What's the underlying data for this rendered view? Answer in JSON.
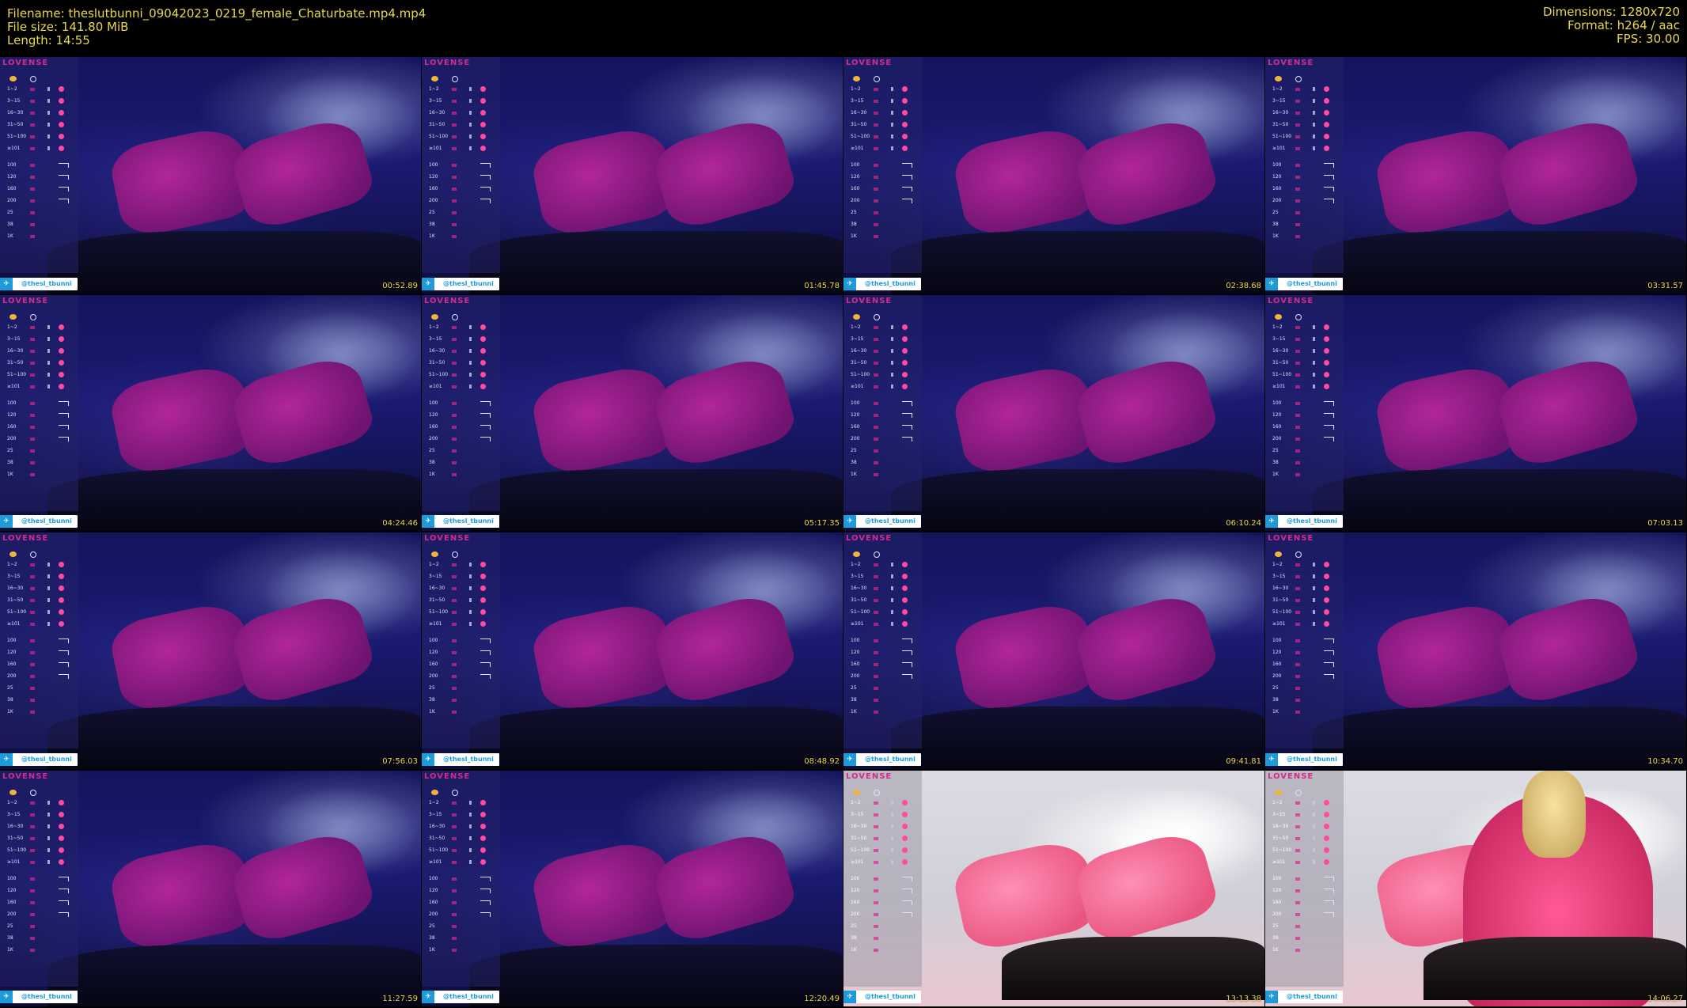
{
  "header": {
    "filename": "Filename: theslutbunni_09042023_0219_female_Chaturbate.mp4.mp4",
    "filesize": "File size: 141.80 MiB",
    "length": "Length: 14:55",
    "dimensions": "Dimensions: 1280x720",
    "format": "Format: h264 / aac",
    "fps": "FPS: 30.00"
  },
  "overlay": {
    "brand": "LOVENSE",
    "handle": "@thesl_tbunni",
    "tip_levels": [
      "1~2",
      "3~15",
      "16~30",
      "31~50",
      "51~100",
      "≥101"
    ],
    "patterns": [
      "100",
      "120",
      "160",
      "200"
    ],
    "extras": [
      "25",
      "38",
      "1K"
    ]
  },
  "thumbnails": [
    {
      "time": "00:52.89",
      "scene": "dark"
    },
    {
      "time": "01:45.78",
      "scene": "dark"
    },
    {
      "time": "02:38.68",
      "scene": "dark"
    },
    {
      "time": "03:31.57",
      "scene": "dark"
    },
    {
      "time": "04:24.46",
      "scene": "dark"
    },
    {
      "time": "05:17.35",
      "scene": "dark"
    },
    {
      "time": "06:10.24",
      "scene": "dark"
    },
    {
      "time": "07:03.13",
      "scene": "dark"
    },
    {
      "time": "07:56.03",
      "scene": "dark"
    },
    {
      "time": "08:48.92",
      "scene": "dark"
    },
    {
      "time": "09:41.81",
      "scene": "dark"
    },
    {
      "time": "10:34.70",
      "scene": "dark"
    },
    {
      "time": "11:27.59",
      "scene": "dark"
    },
    {
      "time": "12:20.49",
      "scene": "dark"
    },
    {
      "time": "13:13.38",
      "scene": "bright"
    },
    {
      "time": "14:06.27",
      "scene": "bright-person"
    }
  ]
}
